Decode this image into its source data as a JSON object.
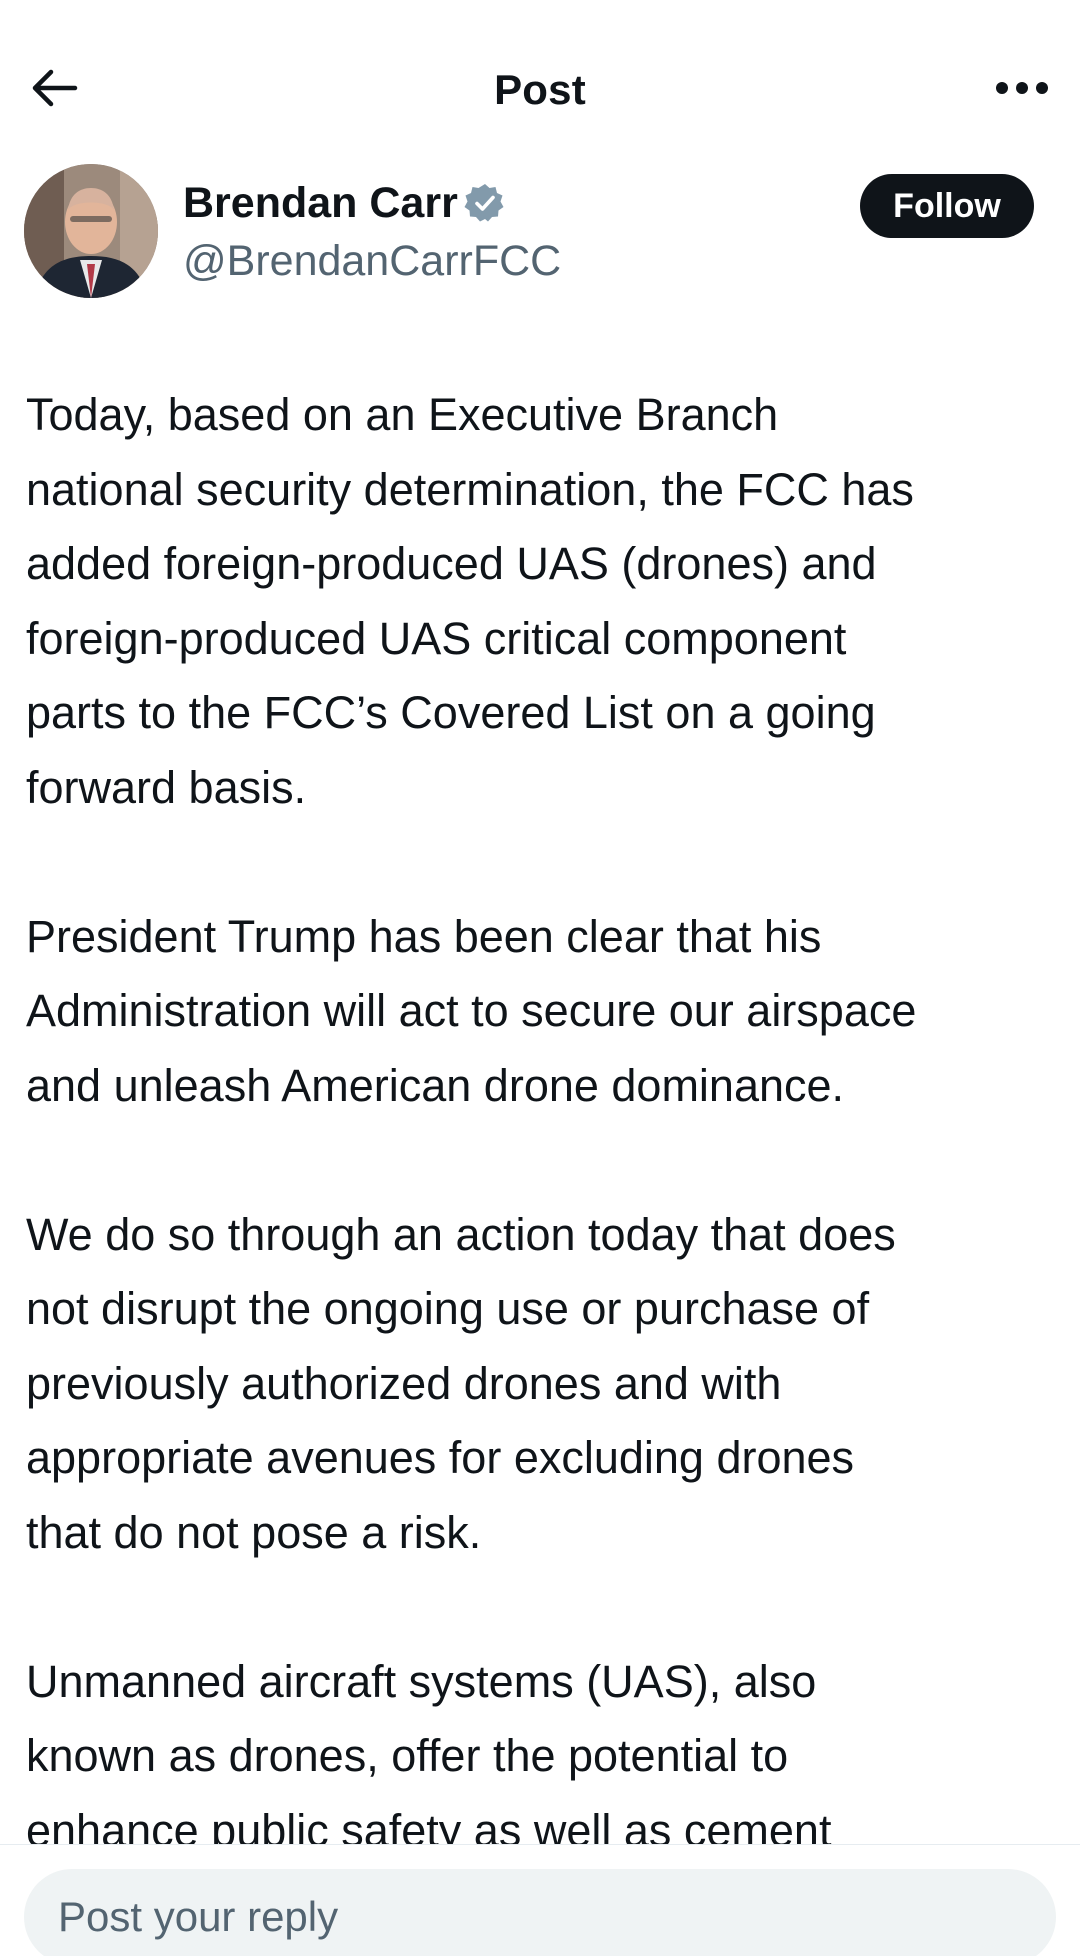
{
  "header": {
    "title": "Post",
    "back_icon": "arrow-left-icon",
    "more_icon": "more-horizontal-icon"
  },
  "author": {
    "name": "Brendan Carr",
    "handle": "@BrendanCarrFCC",
    "verified_icon": "verified-badge-icon",
    "verified_color": "#829aab",
    "follow_label": "Follow"
  },
  "post": {
    "paragraphs": [
      "Today, based on an Executive Branch\nnational security determination, the FCC has\nadded foreign-produced UAS (drones) and\nforeign-produced UAS critical component\nparts to the FCC’s Covered List on a going\nforward basis.",
      "President Trump has been clear that his\nAdministration will act to secure our airspace\nand unleash American drone dominance.",
      "We do so through an action today that does\nnot disrupt the ongoing use or purchase of\npreviously authorized drones and with\nappropriate avenues for excluding drones\nthat do not pose a risk.",
      "Unmanned aircraft systems (UAS), also\nknown as drones, offer the potential to\nenhance public safety as well as cement"
    ]
  },
  "reply": {
    "placeholder": "Post your reply"
  },
  "colors": {
    "text": "#0f1419",
    "secondary": "#536471",
    "follow_bg": "#0f1419",
    "reply_bg": "#eff3f4"
  }
}
